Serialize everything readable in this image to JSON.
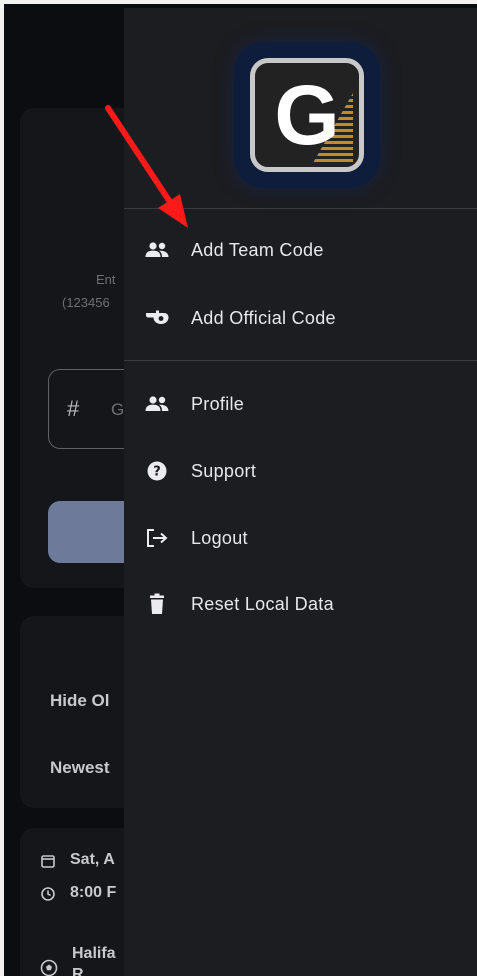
{
  "background": {
    "enter_hint_line1": "Ent",
    "enter_hint_line2": "(123456",
    "code_input_placeholder": "G",
    "code_input_hash": "#",
    "hide_label": "Hide Ol",
    "sort_label": "Newest",
    "game_date": "Sat, A",
    "game_time": "8:00 F",
    "game_location_line1": "Halifa",
    "game_location_line2": "R"
  },
  "drawer": {
    "logo_letter": "G",
    "menu": [
      {
        "label": "Add Team Code",
        "icon": "group-icon"
      },
      {
        "label": "Add Official Code",
        "icon": "whistle-icon"
      },
      {
        "label": "Profile",
        "icon": "group-icon"
      },
      {
        "label": "Support",
        "icon": "help-icon"
      },
      {
        "label": "Logout",
        "icon": "logout-icon"
      },
      {
        "label": "Reset Local Data",
        "icon": "trash-icon"
      }
    ]
  },
  "colors": {
    "drawer_bg": "#1c1d21",
    "page_bg": "#0c0d10",
    "annotation_arrow": "#ff1a1a",
    "logo_bg": "#0e1d3b",
    "logo_accent": "#e39a2e"
  }
}
